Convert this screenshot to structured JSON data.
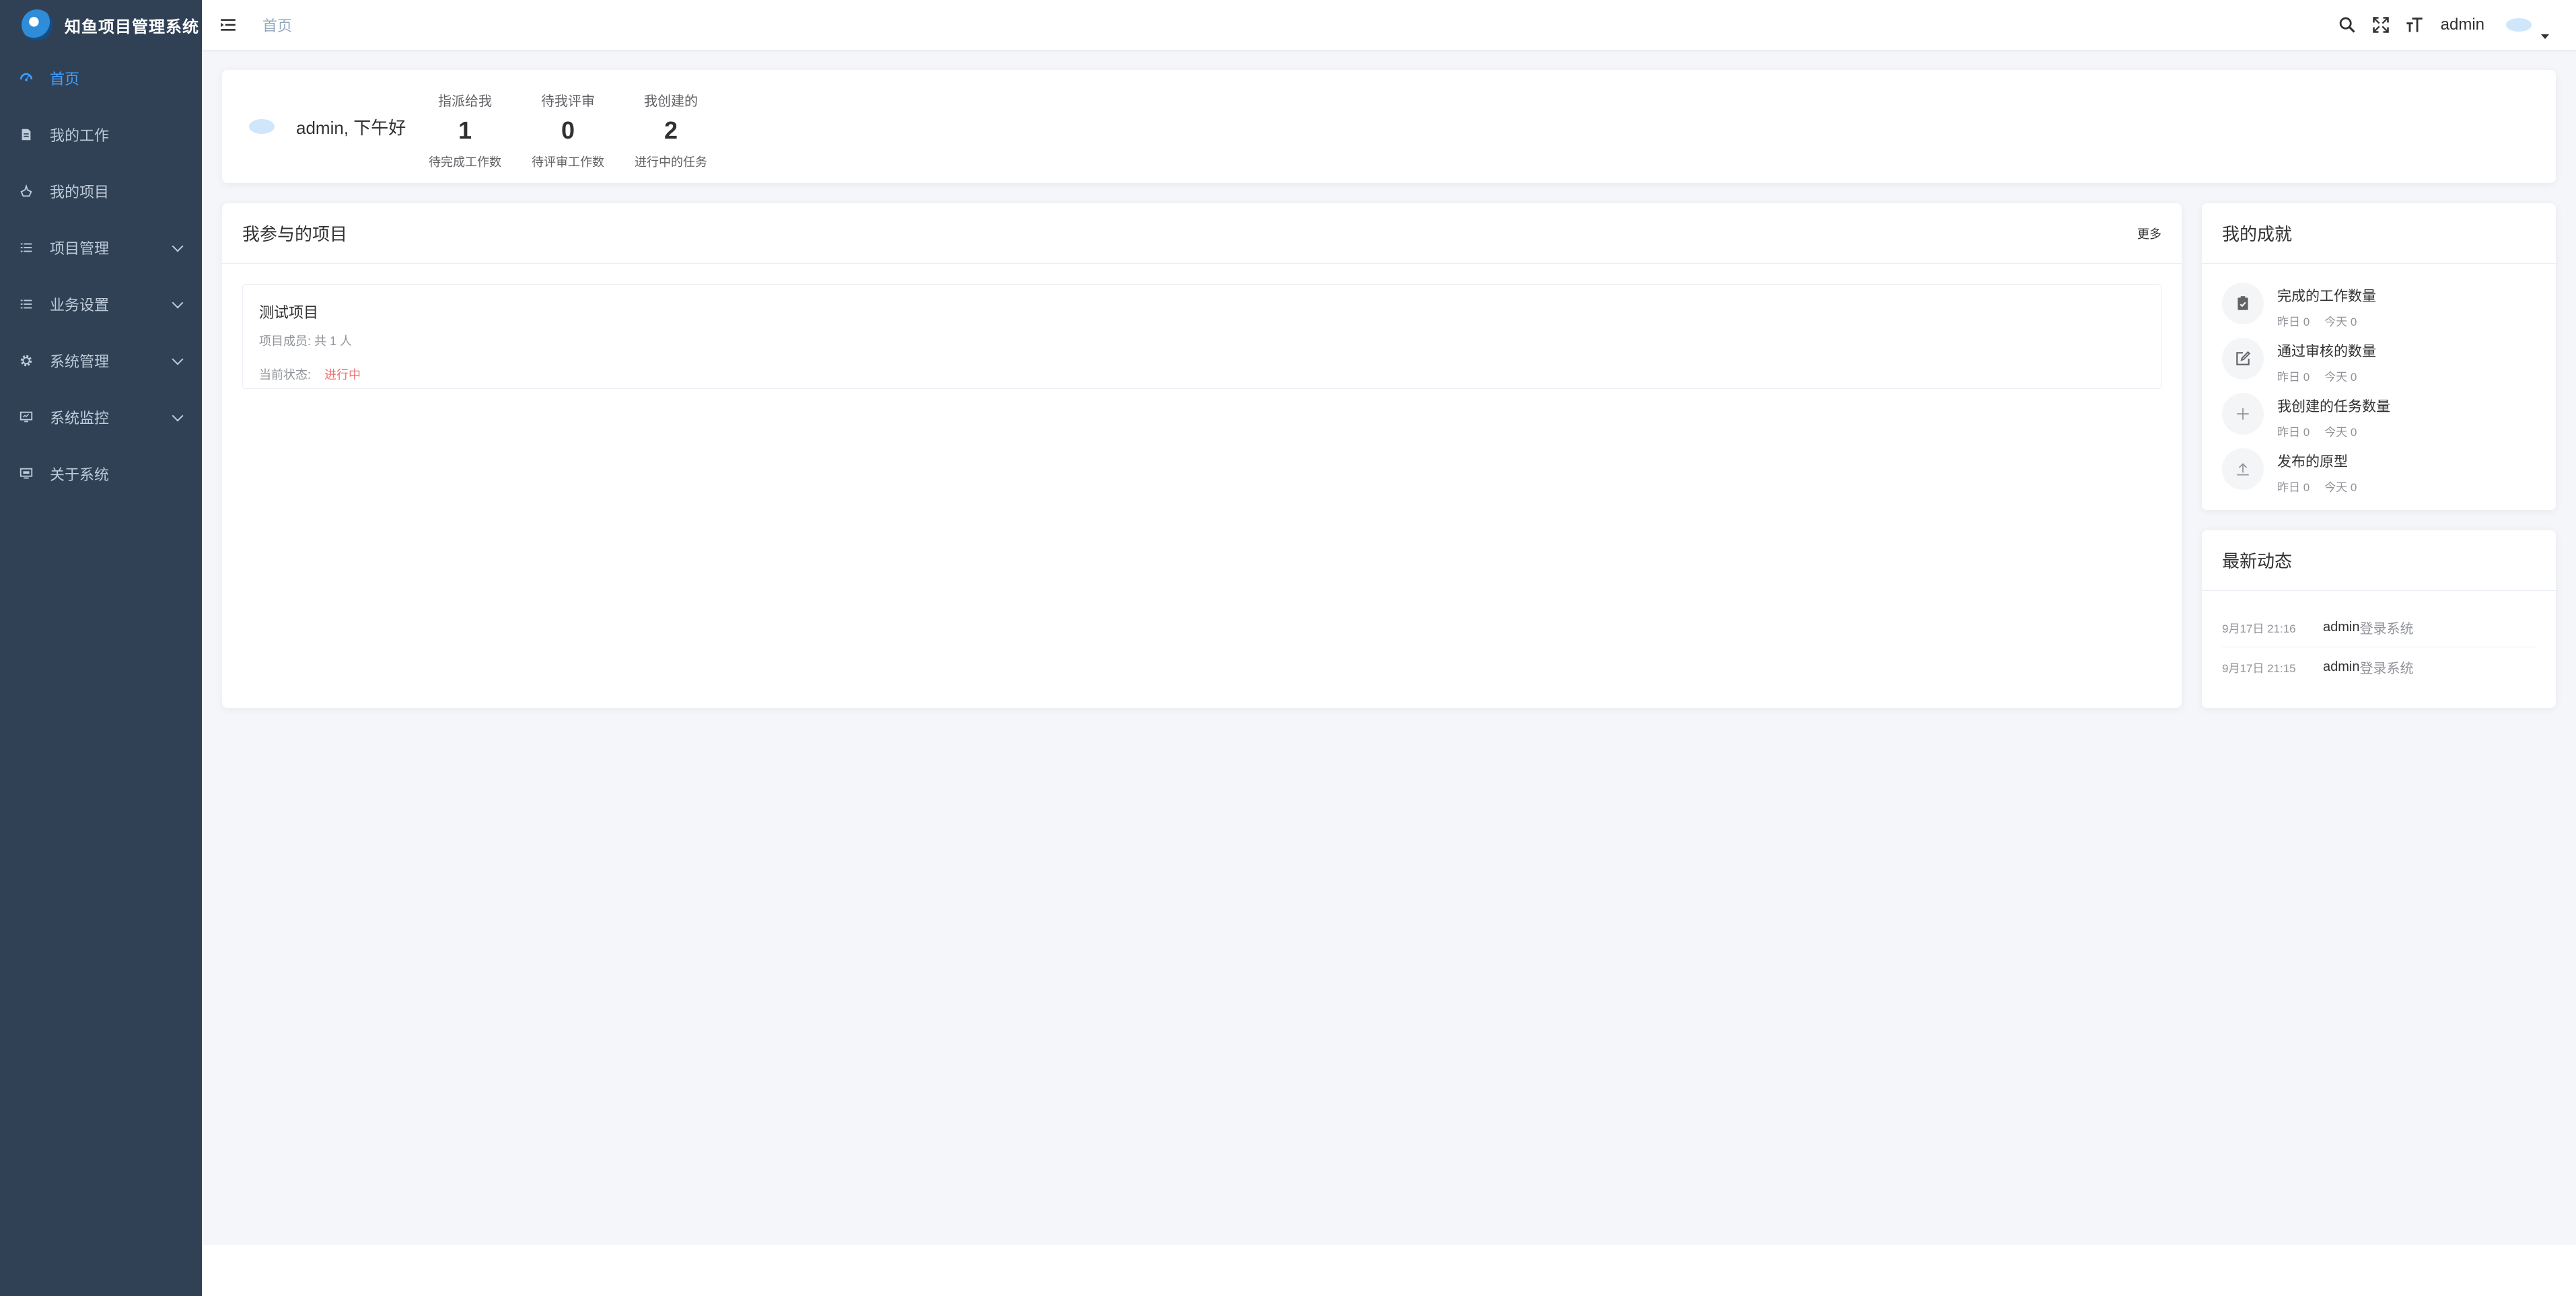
{
  "app": {
    "title": "知鱼项目管理系统"
  },
  "sidebar": {
    "items": [
      {
        "label": "首页",
        "icon": "dashboard-icon",
        "active": true,
        "has_children": false
      },
      {
        "label": "我的工作",
        "icon": "document-icon",
        "active": false,
        "has_children": false
      },
      {
        "label": "我的项目",
        "icon": "project-icon",
        "active": false,
        "has_children": false
      },
      {
        "label": "项目管理",
        "icon": "list-icon",
        "active": false,
        "has_children": true
      },
      {
        "label": "业务设置",
        "icon": "list-icon",
        "active": false,
        "has_children": true
      },
      {
        "label": "系统管理",
        "icon": "gear-icon",
        "active": false,
        "has_children": true
      },
      {
        "label": "系统监控",
        "icon": "monitor-icon",
        "active": false,
        "has_children": true
      },
      {
        "label": "关于系统",
        "icon": "info-monitor-icon",
        "active": false,
        "has_children": false
      }
    ]
  },
  "header": {
    "breadcrumb": "首页",
    "user": "admin"
  },
  "welcome": {
    "greeting": "admin, 下午好",
    "stats": [
      {
        "title": "指派给我",
        "value": "1",
        "sub": "待完成工作数"
      },
      {
        "title": "待我评审",
        "value": "0",
        "sub": "待评审工作数"
      },
      {
        "title": "我创建的",
        "value": "2",
        "sub": "进行中的任务"
      }
    ]
  },
  "projects": {
    "title": "我参与的项目",
    "more": "更多",
    "items": [
      {
        "name": "测试项目",
        "members": "项目成员: 共 1 人",
        "status_label": "当前状态:",
        "status": "进行中"
      }
    ]
  },
  "achievements": {
    "title": "我的成就",
    "items": [
      {
        "title": "完成的工作数量",
        "yesterday": "昨日 0",
        "today": "今天 0",
        "icon": "clipboard-check-icon"
      },
      {
        "title": "通过审核的数量",
        "yesterday": "昨日 0",
        "today": "今天 0",
        "icon": "edit-icon"
      },
      {
        "title": "我创建的任务数量",
        "yesterday": "昨日 0",
        "today": "今天 0",
        "icon": "plus-icon"
      },
      {
        "title": "发布的原型",
        "yesterday": "昨日 0",
        "today": "今天 0",
        "icon": "upload-icon"
      }
    ]
  },
  "activity": {
    "title": "最新动态",
    "items": [
      {
        "time": "9月17日 21:16",
        "user": "admin",
        "text": "登录系统"
      },
      {
        "time": "9月17日 21:15",
        "user": "admin",
        "text": "登录系统"
      }
    ]
  },
  "colors": {
    "sidebar_bg": "#304156",
    "accent": "#409eff",
    "status_red": "#f56c6c"
  }
}
